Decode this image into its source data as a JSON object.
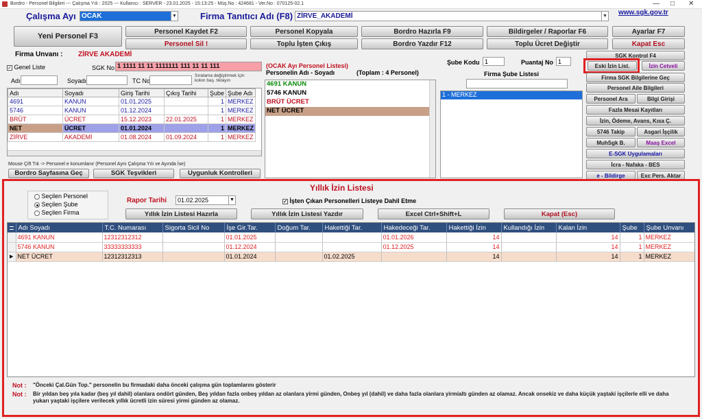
{
  "window_title": "Bordro - Personel Bilgileri  ---  Çalışma Yılı : 2025  ---  Kullanıcı : SERVER - 23.01.2025 - 15:13:25 - Müş.No : 424681 - Ver.No : 070125-02.1",
  "header": {
    "calisma_ayi_label": "Çalışma Ayı",
    "calisma_ayi_value": "OCAK",
    "firma_tanitici_label": "Firma Tanıtıcı Adı (F8)",
    "firma_tanitici_value": "ZİRVE_AKADEMİ",
    "sgk_link": "www.sgk.gov.tr"
  },
  "buttons": {
    "yeni_personel": "Yeni Personel F3",
    "personel_kaydet": "Personel Kaydet F2",
    "personel_kopyala": "Personel Kopyala",
    "bordro_hazirla": "Bordro Hazırla F9",
    "bildirgeler": "Bildirgeler / Raporlar F6",
    "ayarlar": "Ayarlar F7",
    "personel_sil": "Personel Sil !",
    "toplu_isten_cikis": "Toplu İşten Çıkış",
    "bordro_yazdir": "Bordro Yazdır F12",
    "toplu_ucret": "Toplu Ücret Değiştir",
    "kapat_esc": "Kapat Esc"
  },
  "firm": {
    "unvan_label": "Firma Unvanı :",
    "unvan_value": "ZİRVE AKADEMİ",
    "genel_liste": "Genel Liste",
    "sgk_no_label": "SGK No",
    "sgk_no_value": "1 1111 11 11 1111111 111 11 11 111"
  },
  "filter": {
    "adi_label": "Adı",
    "soyadi_label": "Soyadı",
    "tc_no_label": "TC No",
    "sort_hint": "Sıralama değiştirmek için kolon baş. tıklayın"
  },
  "personel_table": {
    "headers": [
      "Adı",
      "Soyadı",
      "Giriş Tarihi",
      "Çıkış Tarihi",
      "Şube",
      "Şube Adı"
    ],
    "rows": [
      {
        "adi": "4691",
        "soyadi": "KANUN",
        "giris": "01.01.2025",
        "cikis": "",
        "sube": "1",
        "sube_adi": "MERKEZ"
      },
      {
        "adi": "5746",
        "soyadi": "KANUN",
        "giris": "01.12.2024",
        "cikis": "",
        "sube": "1",
        "sube_adi": "MERKEZ"
      },
      {
        "adi": "BRÜT",
        "soyadi": "ÜCRET",
        "giris": "15.12.2023",
        "cikis": "22.01.2025",
        "sube": "1",
        "sube_adi": "MERKEZ"
      },
      {
        "adi": "NET",
        "soyadi": "ÜCRET",
        "giris": "01.01.2024",
        "cikis": "",
        "sube": "1",
        "sube_adi": "MERKEZ"
      },
      {
        "adi": "ZİRVE",
        "soyadi": "AKADEMİ",
        "giris": "01.08.2024",
        "cikis": "01.09.2024",
        "sube": "1",
        "sube_adi": "MERKEZ"
      }
    ]
  },
  "hint_text": "Mouse Çift Tık -> Personel e konumlanır (Personel Aynı Çalışma Yılı ve Ayında İse)",
  "bottom_buttons": {
    "bordro_sayfasina": "Bordro Sayfasına Geç",
    "sgk_tesvikleri": "SGK Teşvikleri",
    "uygunluk": "Uygunluk Kontrolleri"
  },
  "personel_listesi": {
    "title": "(OCAK Ayı Personel Listesi)",
    "col_label": "Personelin Adı - Soyadı",
    "toplam": "(Toplam : 4 Personel)",
    "items": [
      "4691 KANUN",
      "5746 KANUN",
      "BRÜT ÜCRET",
      "NET ÜCRET"
    ]
  },
  "sube": {
    "sube_kodu_label": "Şube Kodu",
    "sube_kodu_value": "1",
    "puantaj_label": "Puantaj No",
    "puantaj_value": "1",
    "firma_sube_label": "Firma Şube Listesi",
    "sube_items": [
      "1 - MERKEZ"
    ]
  },
  "right_panel": {
    "sgk_kontrol": "SGK Kontrol F4",
    "eski_izin": "Eski İzin List.",
    "izin_cetveli": "İzin Cetveli",
    "firma_sgk": "Firma SGK Bilgilerine Geç",
    "personel_aile": "Personel Aile Bilgileri",
    "personel_ara": "Personel Ara",
    "bilgi_girisi": "Bilgi Girişi",
    "fazla_mesai": "Fazla Mesai Kayıtları",
    "izin_odeme": "İzin, Ödeme, Avans, Kısa Ç.",
    "takip_5746": "5746 Takip",
    "asgari_iscilik": "Asgari İşçilik",
    "muhsgk": "MuhSgk B.",
    "maas_excel": "Maaş Excel",
    "esgk": "E-SGK Uygulamaları",
    "icra": "İcra - Nafaka - BES",
    "e_bildirge": "e - Bildirge",
    "exc_pers": "Exc Pers. Aktar"
  },
  "izin_panel": {
    "title": "Yıllık İzin Listesi",
    "radio_options": [
      "Seçilen Personel",
      "Seçilen Şube",
      "Seçilen Firma"
    ],
    "radio_selected": 1,
    "rapor_tarihi_label": "Rapor Tarihi",
    "rapor_tarihi_value": "01.02.2025",
    "isten_cikan_label": "İşten Çıkan Personelleri Listeye Dahil Etme",
    "btn_hazirla": "Yıllık İzin Listesi Hazırla",
    "btn_yazdir": "Yıllık İzin Listesi Yazdır",
    "btn_excel": "Excel Ctrl+Shift+L",
    "btn_kapat": "Kapat (Esc)",
    "headers": [
      "Adı Soyadı",
      "T.C. Numarası",
      "Sigorta Sicil No",
      "İşe Gir.Tar.",
      "Doğum Tar.",
      "Hakettiği Tar.",
      "Hakedeceği Tar.",
      "Hakettiği İzin",
      "Kullandığı İzin",
      "Kalan İzin",
      "Şube",
      "Şube Unvanı"
    ],
    "rows": [
      {
        "adi": "4691 KANUN",
        "tc": "12312312312",
        "sicil": "",
        "ise_gir": "01.01.2025",
        "dogum": "",
        "hakettigi_tar": "",
        "hakedecegi_tar": "01.01.2026",
        "hakettigi_izin": "14",
        "kullandigi": "",
        "kalan": "14",
        "sube": "1",
        "sube_unvani": "MERKEZ"
      },
      {
        "adi": "5746 KANUN",
        "tc": "33333333333",
        "sicil": "",
        "ise_gir": "01.12.2024",
        "dogum": "",
        "hakettigi_tar": "",
        "hakedecegi_tar": "01.12.2025",
        "hakettigi_izin": "14",
        "kullandigi": "",
        "kalan": "14",
        "sube": "1",
        "sube_unvani": "MERKEZ"
      },
      {
        "adi": "NET ÜCRET",
        "tc": "12312312313",
        "sicil": "",
        "ise_gir": "01.01.2024",
        "dogum": "",
        "hakettigi_tar": "01.02.2025",
        "hakedecegi_tar": "",
        "hakettigi_izin": "14",
        "kullandigi": "",
        "kalan": "14",
        "sube": "1",
        "sube_unvani": "MERKEZ"
      }
    ],
    "not1_label": "Not :",
    "not1_text": "\"Önceki Çal.Gün Top.\" personelin bu firmadaki daha önceki çalışma gün toplamlarını gösterir",
    "not2_label": "Not :",
    "not2_text": "Bir yıldan beş yıla kadar (beş yıl dahil) olanlara ondört günden,  Beş yıldan fazla onbeş yıldan az olanlara yirmi günden, Onbeş yıl (dahil) ve daha fazla olanlara yirmialtı günden az olamaz. Ancak onsekiz ve daha küçük yaştaki işçilerle elli ve daha yukarı yaştaki işçilere verilecek yıllık ücretli izin süresi yirmi günden az olamaz."
  },
  "colors": {
    "highlight_red": "#e02020",
    "grid_header": "#2f4f7f",
    "selected_blue": "#1e6fd9"
  }
}
